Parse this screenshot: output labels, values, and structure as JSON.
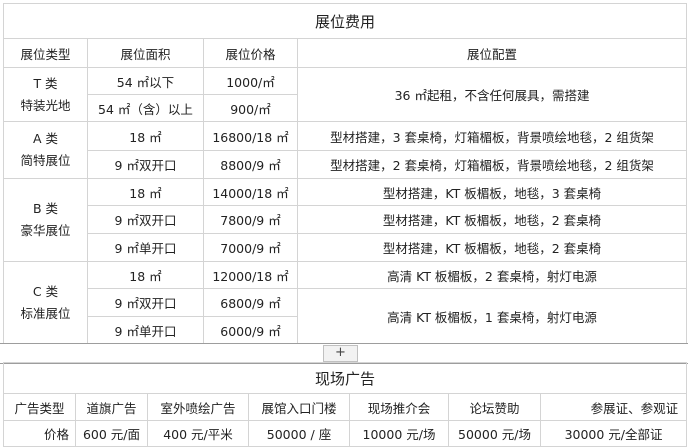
{
  "booth_fees": {
    "title": "展位费用",
    "headers": [
      "展位类型",
      "展位面积",
      "展位价格",
      "展位配置"
    ],
    "groups": [
      {
        "type_line1": "T 类",
        "type_line2": "特装光地",
        "rows": [
          {
            "area": "54 ㎡以下",
            "price": "1000/㎡"
          },
          {
            "area": "54 ㎡（含）以上",
            "price": "900/㎡"
          }
        ],
        "config": "36 ㎡起租，不含任何展具，需搭建"
      },
      {
        "type_line1": "A 类",
        "type_line2": "简特展位",
        "rows": [
          {
            "area": "18 ㎡",
            "price": "16800/18 ㎡",
            "config": "型材搭建，3 套桌椅，灯箱楣板，背景喷绘地毯，2 组货架"
          },
          {
            "area": "9 ㎡双开口",
            "price": "8800/9 ㎡",
            "config": "型材搭建，2 套桌椅，灯箱楣板，背景喷绘地毯，2 组货架"
          }
        ]
      },
      {
        "type_line1": "B 类",
        "type_line2": "豪华展位",
        "rows": [
          {
            "area": "18 ㎡",
            "price": "14000/18 ㎡",
            "config": "型材搭建，KT 板楣板，地毯，3 套桌椅"
          },
          {
            "area": "9 ㎡双开口",
            "price": "7800/9 ㎡",
            "config": "型材搭建，KT 板楣板，地毯，2 套桌椅"
          },
          {
            "area": "9 ㎡单开口",
            "price": "7000/9 ㎡",
            "config": "型材搭建，KT 板楣板，地毯，2 套桌椅"
          }
        ]
      },
      {
        "type_line1": "C 类",
        "type_line2": "标准展位",
        "rows": [
          {
            "area": "18 ㎡",
            "price": "12000/18 ㎡",
            "config": "高清 KT 板楣板，2 套桌椅，射灯电源"
          },
          {
            "area": "9 ㎡双开口",
            "price": "6800/9 ㎡"
          },
          {
            "area": "9 ㎡单开口",
            "price": "6000/9 ㎡"
          }
        ],
        "config_shared": "高清 KT 板楣板，1 套桌椅，射灯电源"
      }
    ]
  },
  "expand_button": "+",
  "ads": {
    "title": "现场广告",
    "headers": [
      "广告类型",
      "道旗广告",
      "室外喷绘广告",
      "展馆入口门楼",
      "现场推介会",
      "论坛赞助",
      "参展证、参观证"
    ],
    "price_label": "价格",
    "prices": [
      "600 元/面",
      "400 元/平米",
      "50000 / 座",
      "10000 元/场",
      "50000 元/场",
      "30000 元/全部证"
    ]
  }
}
